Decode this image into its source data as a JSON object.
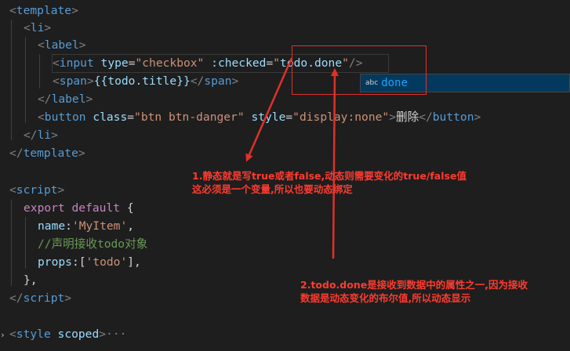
{
  "code": {
    "l1": {
      "lt": "<",
      "tag": "template",
      "gt": ">"
    },
    "l2": {
      "lt": "<",
      "tag": "li",
      "gt": ">"
    },
    "l3": {
      "lt": "<",
      "tag": "label",
      "gt": ">"
    },
    "l4": {
      "lt": "<",
      "tag": "input",
      "attr1": "type",
      "eq": "=",
      "val1": "\"checkbox\"",
      "attr2": ":checked",
      "val2a": "\"",
      "val2b": "todo.done",
      "val2c": "\"",
      "end": "/>"
    },
    "l5": {
      "lt": "<",
      "tag": "span",
      "gt": ">",
      "mustache": "{{todo.title}}",
      "lt2": "</",
      "tag2": "span",
      "gt2": ">"
    },
    "l6": {
      "lt": "</",
      "tag": "label",
      "gt": ">"
    },
    "l7": {
      "lt": "<",
      "tag": "button",
      "attr1": "class",
      "val1": "\"btn btn-danger\"",
      "attr2": "style",
      "val2": "\"display:none\"",
      "gt": ">",
      "text": "删除",
      "lt2": "</",
      "tag2": "button",
      "gt2": ">"
    },
    "l8": {
      "lt": "</",
      "tag": "li",
      "gt": ">"
    },
    "l9": {
      "lt": "</",
      "tag": "template",
      "gt": ">"
    },
    "l11": {
      "lt": "<",
      "tag": "script",
      "gt": ">"
    },
    "l12": {
      "kw": "export",
      "kw2": "default",
      "brace": "{"
    },
    "l13": {
      "prop": "name",
      "colon": ":",
      "str": "'MyItem'",
      "comma": ","
    },
    "l14": {
      "comment": "//声明接收todo对象"
    },
    "l15": {
      "prop": "props",
      "colon": ":",
      "open": "[",
      "str": "'todo'",
      "close": "]",
      "comma": ","
    },
    "l16": {
      "brace": "},"
    },
    "l17": {
      "lt": "</",
      "tag": "script",
      "gt": ">"
    },
    "l19": {
      "lt": "<",
      "tag": "style",
      "attr": "scoped",
      "gt": ">",
      "ellipsis": "···"
    }
  },
  "suggestion": {
    "icon": "abc",
    "text": "done"
  },
  "notes": {
    "note1": "1.静态就是写true或者false,动态则需要变化的true/false值\n这必须是一个变量,所以也要动态绑定",
    "note2": "2.todo.done是接收到数据中的属性之一,因为接收\n数据是动态变化的布尔值,所以动态显示"
  },
  "colors": {
    "annotation": "#ff3b30",
    "background": "#1e1e1e"
  }
}
